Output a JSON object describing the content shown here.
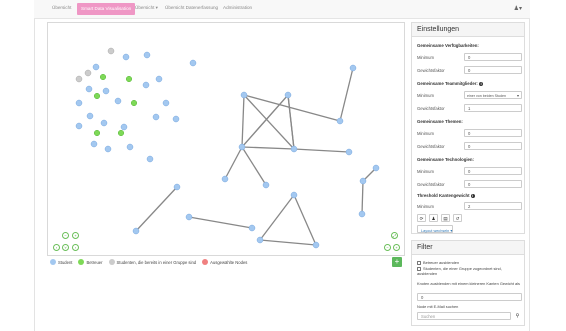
{
  "nav": {
    "items": [
      "Übersicht",
      "Smart Data Visualisation",
      "Übersicht ▾",
      "Übersicht Datenerfassung",
      "Administration"
    ],
    "active_index": 1,
    "user_icon": "user-icon"
  },
  "legend": {
    "items": [
      {
        "label": "Student",
        "color": "#a3c8f0"
      },
      {
        "label": "Betreuer",
        "color": "#7ed957"
      },
      {
        "label": "Studenten, die bereits in einer Gruppe sind",
        "color": "#cccccc"
      },
      {
        "label": "Ausgewählte Nodes",
        "color": "#f08080"
      }
    ]
  },
  "colors": {
    "student": "#a3c8f0",
    "student_stroke": "#7aa9df",
    "betreuer": "#7ed957",
    "grouped": "#cccccc",
    "edge": "#888888",
    "accent": "#ef97c5",
    "add": "#5cb85c"
  },
  "settings": {
    "title": "Einstellungen",
    "sections": [
      {
        "title": "Gemeinsame Verfügbarkeiten:",
        "info": false,
        "rows": [
          {
            "label": "Minimum",
            "value": "0"
          },
          {
            "label": "Gewichtsfaktor",
            "value": "0"
          }
        ]
      },
      {
        "title": "Gemeinsame Teammitglieder:",
        "info": true,
        "rows": [
          {
            "label": "Minimum",
            "select": "einer von beiden Studen"
          },
          {
            "label": "Gewichtsfaktor",
            "value": "1"
          }
        ]
      },
      {
        "title": "Gemeinsame Themen:",
        "info": false,
        "rows": [
          {
            "label": "Minimum",
            "value": "0"
          },
          {
            "label": "Gewichtsfaktor",
            "value": "0"
          }
        ]
      },
      {
        "title": "Gemeinsame Technologien:",
        "info": false,
        "rows": [
          {
            "label": "Minimum",
            "value": "0"
          },
          {
            "label": "Gewichtsfaktor",
            "value": "0"
          }
        ]
      },
      {
        "title": "Threshold Kantengewicht",
        "info": true,
        "rows": [
          {
            "label": "Minimum",
            "value": "2"
          }
        ]
      }
    ],
    "buttons": [
      "refresh-icon",
      "user-icon",
      "print-icon",
      "undo-icon"
    ],
    "layout_button": "Layout wechseln ▾"
  },
  "filter": {
    "title": "Filter",
    "checks": [
      "Betreuer ausblenden",
      "Studenten, die einer Gruppe zugeordnet sind, ausblenden"
    ],
    "edge_label": "Knoten ausblenden mit einem kleineren Kanten Gewicht als",
    "edge_value": "0",
    "email_label": "Node mit E-Mail suchen",
    "search_placeholder": "Suchen",
    "search_icon": "search-icon"
  }
}
